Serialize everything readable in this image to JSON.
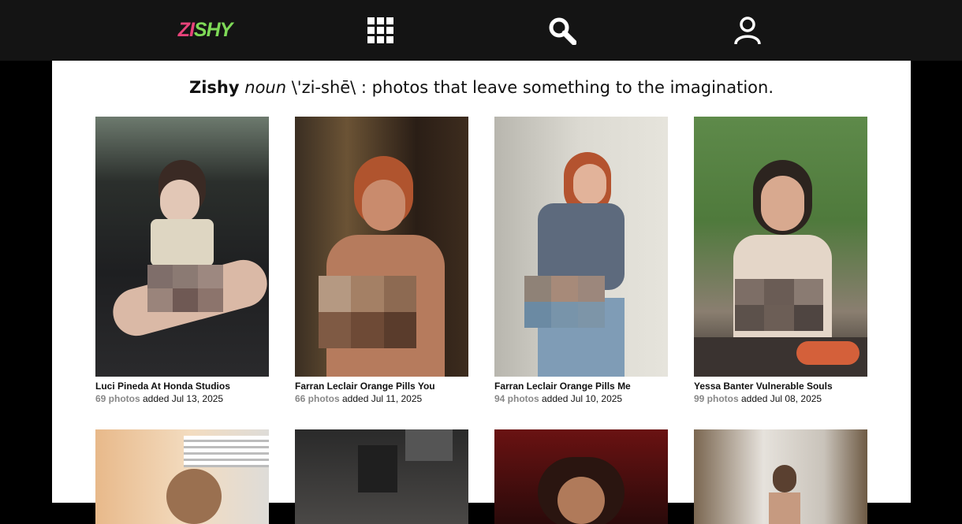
{
  "header": {
    "logo_part1": "ZI",
    "logo_part2": "SHY",
    "icons": [
      "grid-icon",
      "search-icon",
      "user-icon"
    ]
  },
  "tagline": {
    "brand": "Zishy",
    "pos": "noun",
    "pronunciation": " \\'zi-shē\\ : photos that leave something to the imagination."
  },
  "galleries": [
    {
      "title": "Luci Pineda At Honda Studios",
      "count": "69 photos",
      "added": " added Jul 13, 2025"
    },
    {
      "title": "Farran Leclair Orange Pills You",
      "count": "66 photos",
      "added": " added Jul 11, 2025"
    },
    {
      "title": "Farran Leclair Orange Pills Me",
      "count": "94 photos",
      "added": " added Jul 10, 2025"
    },
    {
      "title": "Yessa Banter Vulnerable Souls",
      "count": "99 photos",
      "added": " added Jul 08, 2025"
    }
  ],
  "colors": {
    "header_bg": "#141414",
    "logo_pink": "#e8437a",
    "logo_green": "#7ed957",
    "count_gray": "#888888"
  }
}
